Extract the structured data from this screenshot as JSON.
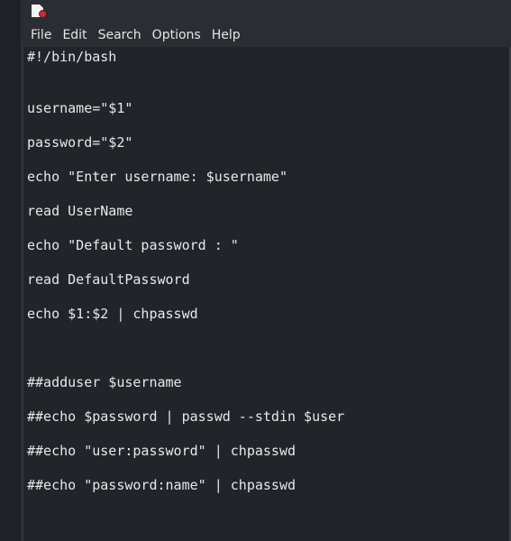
{
  "menu": {
    "file": "File",
    "edit": "Edit",
    "search": "Search",
    "options": "Options",
    "help": "Help"
  },
  "icons": {
    "app": "text-editor-icon"
  },
  "code_lines": [
    "#!/bin/bash",
    "username=\"$1\"",
    "password=\"$2\"",
    "echo \"Enter username: $username\"",
    "read UserName",
    "echo \"Default password : \"",
    "read DefaultPassword",
    "echo $1:$2 | chpasswd",
    "##adduser $username",
    "##echo $password | passwd --stdin $user",
    "##echo \"user:password\" | chpasswd",
    "##echo \"password:name\" | chpasswd"
  ],
  "colors": {
    "background": "#22242a",
    "window": "#2b2d33",
    "text": "#e8e8e8"
  }
}
